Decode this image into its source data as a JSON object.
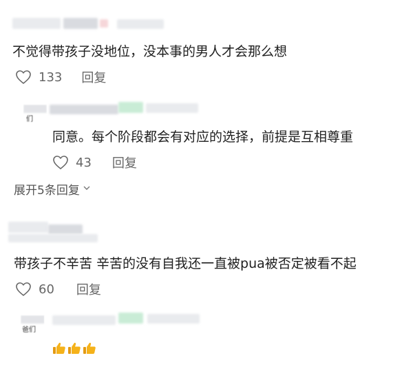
{
  "comments": [
    {
      "text": "不觉得带孩子没地位，没本事的男人才会那么想",
      "likes": "133",
      "reply_label": "回复"
    },
    {
      "text": "同意。每个阶段都会有对应的选择，前提是互相尊重",
      "likes": "43",
      "reply_label": "回复"
    },
    {
      "text": "带孩子不辛苦 辛苦的没有自我还一直被pua被否定被看不起",
      "likes": "60",
      "reply_label": "回复"
    }
  ],
  "expand_replies_label": "展开5条回复",
  "avatar_partial_text_1": "们",
  "avatar_partial_text_2": "爸们",
  "emoji_reply": {
    "icon_names": [
      "thumbs-up-icon",
      "thumbs-up-icon",
      "thumbs-up-icon"
    ]
  },
  "colors": {
    "text": "#1f1f1f",
    "muted": "#666666",
    "thumb": "#f5b21a"
  }
}
